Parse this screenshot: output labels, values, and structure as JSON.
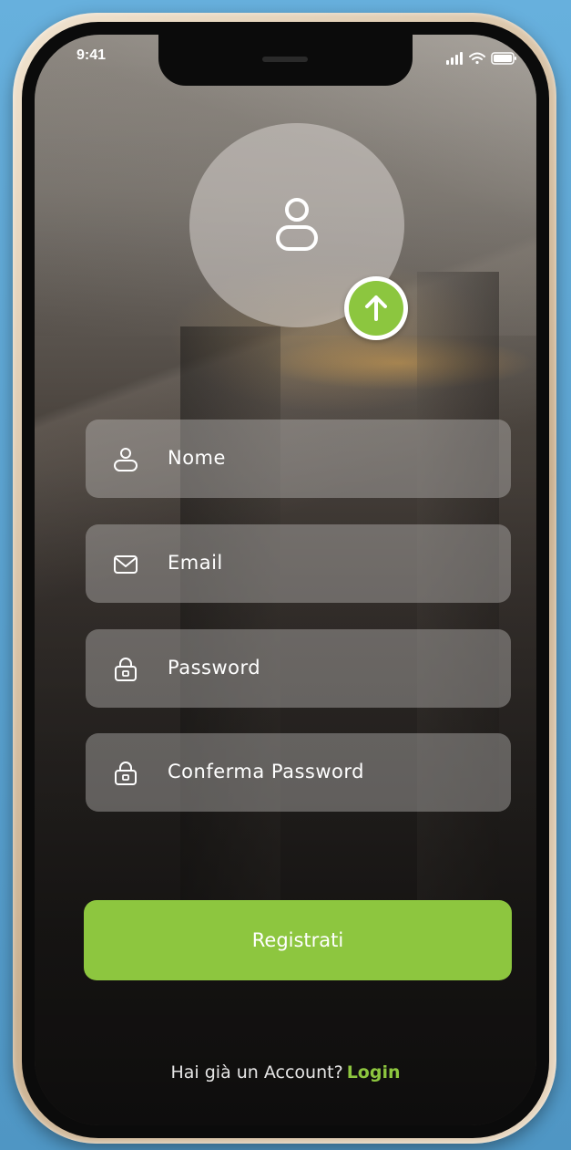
{
  "status_bar": {
    "time": "9:41",
    "icons": [
      "signal-icon",
      "wifi-icon",
      "battery-icon"
    ]
  },
  "avatar": {
    "icon": "user-icon",
    "upload_icon": "arrow-up-icon"
  },
  "form": {
    "fields": [
      {
        "icon": "user-icon",
        "label": "Nome"
      },
      {
        "icon": "mail-icon",
        "label": "Email"
      },
      {
        "icon": "lock-icon",
        "label": "Password"
      },
      {
        "icon": "lock-icon",
        "label": "Conferma Password"
      }
    ],
    "submit_label": "Registrati"
  },
  "footer": {
    "prompt": "Hai già un Account?",
    "link": "Login"
  },
  "colors": {
    "accent": "#8dc63f",
    "background_outer": "#5fa7d4",
    "field_bg": "rgba(190,188,186,0.42)",
    "text": "#ffffff"
  }
}
